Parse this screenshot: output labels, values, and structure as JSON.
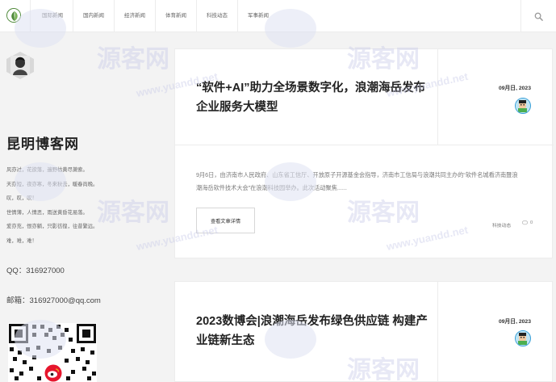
{
  "nav": {
    "items": [
      "国际新闻",
      "国内新闻",
      "经济新闻",
      "体育新闻",
      "科技动态",
      "军事新闻"
    ]
  },
  "sidebar": {
    "site_title": "昆明博客网",
    "motto_lines": [
      "风亦过，花欲落，遍野枯黄尽萧索。",
      "天亦短，夜亦寒，冬来秋去，暖春尚晚。",
      "叹，叹，叹！",
      "世情薄，人情恶，雨送黄昏花易落。",
      "爱亦充，恨亦躺，只影彷徨，往昔繁远。",
      "难，难，难！"
    ],
    "qq": "QQ：316927000",
    "email": "邮箱：316927000@qq.com"
  },
  "posts": [
    {
      "title": "“软件+AI”助力全场景数字化，浪潮海岳发布企业服务大模型",
      "date": "09月日, 2023",
      "excerpt": "9月6日，由济南市人民政府、山东省工信厅、开放原子开源基金会指导，济南市工信局与浪潮共同主办的“软件名城看济南暨浪潮海岳软件技术大会”在浪潮科技园举办。此次活动聚焦......",
      "button": "查看文章详情",
      "category": "科技动态",
      "comments": "0"
    },
    {
      "title": "2023数博会|浪潮海岳发布绿色供应链 构建产业链新生态",
      "date": "09月日, 2023"
    }
  ],
  "watermark": {
    "text": "源客网",
    "url": "www.yuandd.net"
  },
  "colors": {
    "accent_green": "#4f8a3a",
    "avatar_ring": "#3aa0d8"
  },
  "icons": [
    "leaf-logo-icon",
    "search-icon",
    "comment-icon",
    "qr-code-icon",
    "weibo-icon"
  ]
}
